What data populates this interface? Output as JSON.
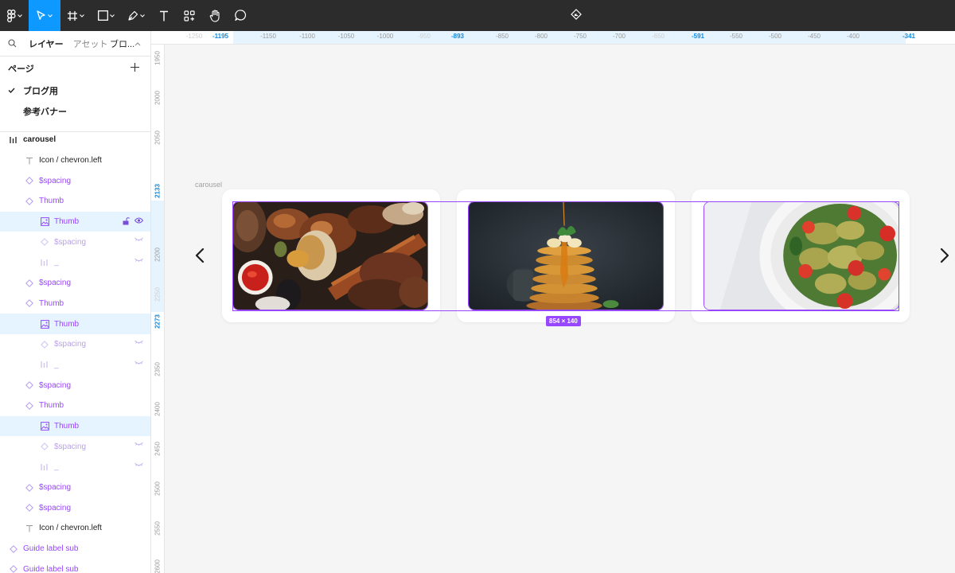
{
  "toolbar": {
    "tools": [
      "main-menu",
      "move",
      "frame",
      "shape",
      "pen",
      "text",
      "resources",
      "hand",
      "comment"
    ],
    "active_tool": "move"
  },
  "left_panel": {
    "tabs": {
      "layers": "レイヤー",
      "assets": "アセット",
      "page_selector": "ブロ..."
    },
    "pages_header": "ページ",
    "pages": [
      {
        "label": "ブログ用",
        "current": true
      },
      {
        "label": "参考バナー",
        "current": false
      }
    ],
    "layers": [
      {
        "label": "carousel",
        "icon": "auto-layout-icon",
        "style": "bold",
        "indent": 10,
        "selected": false
      },
      {
        "label": "Icon / chevron.left",
        "icon": "text-icon",
        "style": "dark",
        "indent": 30,
        "selected": false
      },
      {
        "label": "$spacing",
        "icon": "component-instance-icon",
        "style": "purple",
        "indent": 30,
        "selected": false
      },
      {
        "label": "Thumb",
        "icon": "component-instance-icon",
        "style": "purple",
        "indent": 30,
        "selected": false
      },
      {
        "label": "Thumb",
        "icon": "image-icon",
        "style": "purple",
        "indent": 49,
        "selected": true,
        "controls": true
      },
      {
        "label": "$spacing",
        "icon": "component-instance-icon",
        "style": "faded",
        "indent": 49,
        "selected": false,
        "hidden": true
      },
      {
        "label": "_",
        "icon": "auto-layout-icon",
        "style": "faded",
        "indent": 49,
        "selected": false,
        "hidden": true
      },
      {
        "label": "$spacing",
        "icon": "component-instance-icon",
        "style": "purple",
        "indent": 30,
        "selected": false
      },
      {
        "label": "Thumb",
        "icon": "component-instance-icon",
        "style": "purple",
        "indent": 30,
        "selected": false
      },
      {
        "label": "Thumb",
        "icon": "image-icon",
        "style": "purple",
        "indent": 49,
        "selected": true
      },
      {
        "label": "$spacing",
        "icon": "component-instance-icon",
        "style": "faded",
        "indent": 49,
        "selected": false,
        "hidden": true
      },
      {
        "label": "_",
        "icon": "auto-layout-icon",
        "style": "faded",
        "indent": 49,
        "selected": false,
        "hidden": true
      },
      {
        "label": "$spacing",
        "icon": "component-instance-icon",
        "style": "purple",
        "indent": 30,
        "selected": false
      },
      {
        "label": "Thumb",
        "icon": "component-instance-icon",
        "style": "purple",
        "indent": 30,
        "selected": false
      },
      {
        "label": "Thumb",
        "icon": "image-icon",
        "style": "purple",
        "indent": 49,
        "selected": true
      },
      {
        "label": "$spacing",
        "icon": "component-instance-icon",
        "style": "faded",
        "indent": 49,
        "selected": false,
        "hidden": true
      },
      {
        "label": "_",
        "icon": "auto-layout-icon",
        "style": "faded",
        "indent": 49,
        "selected": false,
        "hidden": true
      },
      {
        "label": "$spacing",
        "icon": "component-instance-icon",
        "style": "purple",
        "indent": 30,
        "selected": false
      },
      {
        "label": "$spacing",
        "icon": "component-instance-icon",
        "style": "purple",
        "indent": 30,
        "selected": false
      },
      {
        "label": "Icon / chevron.left",
        "icon": "text-icon",
        "style": "dark",
        "indent": 30,
        "selected": false
      },
      {
        "label": "Guide label sub",
        "icon": "component-instance-icon",
        "style": "purple",
        "indent": 10,
        "selected": false
      },
      {
        "label": "Guide label sub",
        "icon": "component-instance-icon",
        "style": "purple",
        "indent": 10,
        "selected": false
      }
    ]
  },
  "ruler_top": {
    "ticks": [
      {
        "label": "-1250",
        "kind": "faint"
      },
      {
        "label": "-1195",
        "kind": "blue"
      },
      {
        "label": "-1150",
        "kind": "normal"
      },
      {
        "label": "-1100",
        "kind": "normal"
      },
      {
        "label": "-1050",
        "kind": "normal"
      },
      {
        "label": "-1000",
        "kind": "normal"
      },
      {
        "label": "-950",
        "kind": "faint"
      },
      {
        "label": "-893",
        "kind": "blue"
      },
      {
        "label": "-850",
        "kind": "normal"
      },
      {
        "label": "-800",
        "kind": "normal"
      },
      {
        "label": "-750",
        "kind": "normal"
      },
      {
        "label": "-700",
        "kind": "normal"
      },
      {
        "label": "-650",
        "kind": "faint"
      },
      {
        "label": "-591",
        "kind": "blue"
      },
      {
        "label": "-550",
        "kind": "normal"
      },
      {
        "label": "-500",
        "kind": "normal"
      },
      {
        "label": "-450",
        "kind": "normal"
      },
      {
        "label": "-400",
        "kind": "normal"
      },
      {
        "label": "-341",
        "kind": "blue"
      }
    ]
  },
  "ruler_left": {
    "ticks": [
      {
        "label": "1950",
        "kind": "normal"
      },
      {
        "label": "2000",
        "kind": "normal"
      },
      {
        "label": "2050",
        "kind": "normal"
      },
      {
        "label": "2133",
        "kind": "blue"
      },
      {
        "label": "2200",
        "kind": "normal"
      },
      {
        "label": "2250",
        "kind": "faint"
      },
      {
        "label": "2273",
        "kind": "blue"
      },
      {
        "label": "2350",
        "kind": "normal"
      },
      {
        "label": "2400",
        "kind": "normal"
      },
      {
        "label": "2450",
        "kind": "normal"
      },
      {
        "label": "2500",
        "kind": "normal"
      },
      {
        "label": "2550",
        "kind": "normal"
      },
      {
        "label": "2600",
        "kind": "normal"
      }
    ]
  },
  "canvas": {
    "frame_name": "carousel",
    "selection_dimensions": "854 × 140",
    "thumbnails": [
      "bbq-grilled-meat-image",
      "pancake-stack-image",
      "pasta-salad-image"
    ]
  },
  "colors": {
    "toolbar_bg": "#2c2c2c",
    "active_tool": "#0d99ff",
    "selection": "#9747ff",
    "ruler_highlight": "#e5f4ff",
    "layer_selected": "#e5f4ff"
  }
}
